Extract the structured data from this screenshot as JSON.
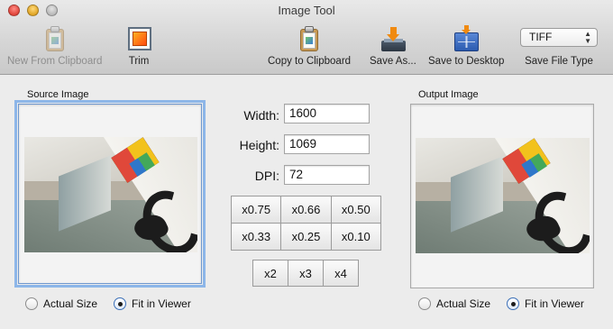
{
  "window": {
    "title": "Image Tool"
  },
  "toolbar": {
    "new_from_clipboard": "New From Clipboard",
    "trim": "Trim",
    "copy_to_clipboard": "Copy to Clipboard",
    "save_as": "Save As...",
    "save_to_desktop": "Save to Desktop",
    "file_type_value": "TIFF",
    "save_file_type": "Save File Type"
  },
  "source": {
    "title": "Source Image",
    "radio_actual": "Actual Size",
    "radio_fit": "Fit in Viewer",
    "selected": "Fit in Viewer"
  },
  "output": {
    "title": "Output Image",
    "radio_actual": "Actual Size",
    "radio_fit": "Fit in Viewer",
    "selected": "Fit in Viewer"
  },
  "fields": {
    "width_label": "Width:",
    "width_value": "1600",
    "height_label": "Height:",
    "height_value": "1069",
    "dpi_label": "DPI:",
    "dpi_value": "72"
  },
  "scale_down": [
    "x0.75",
    "x0.66",
    "x0.50",
    "x0.33",
    "x0.25",
    "x0.10"
  ],
  "scale_up": [
    "x2",
    "x3",
    "x4"
  ]
}
